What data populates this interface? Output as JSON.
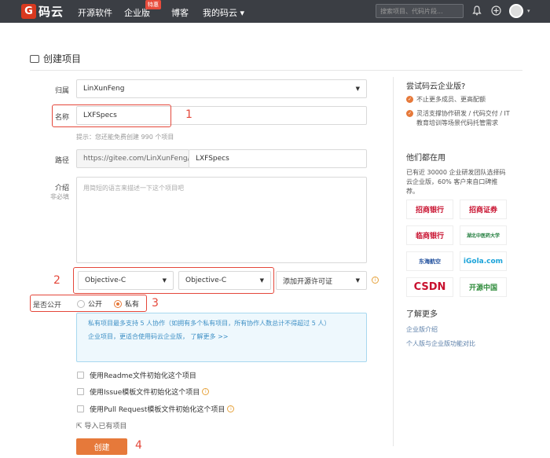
{
  "nav": {
    "logo_letter": "G",
    "logo_text": "码云",
    "items": [
      "开源软件",
      "企业版",
      "博客",
      "我的码云"
    ],
    "badge": "特惠",
    "search_placeholder": "搜索项目、代码片段...",
    "caret": "▾"
  },
  "page": {
    "title": "创建项目"
  },
  "form": {
    "owner_label": "归属",
    "owner_value": "LinXunFeng",
    "name_label": "名称",
    "name_value": "LXFSpecs",
    "name_hint": "提示：您还能免费创建 990 个项目",
    "path_label": "路径",
    "path_prefix": "https://gitee.com/LinXunFeng/",
    "path_value": "LXFSpecs",
    "desc_label": "介绍",
    "desc_sub": "非必填",
    "desc_placeholder": "用简短的语言来描述一下这个项目吧",
    "lang_value": "Objective-C",
    "gitignore_value": "Objective-C",
    "license_placeholder": "添加开源许可证",
    "visibility_label": "是否公开",
    "public_label": "公开",
    "private_label": "私有",
    "info_line1": "私有项目最多支持 5 人协作（如拥有多个私有项目，所有协作人数总计不得超过 5 人）",
    "info_line2": "企业项目，更适合使用码云企业版，  了解更多 >>",
    "cb_readme": "使用Readme文件初始化这个项目",
    "cb_issue": "使用Issue模板文件初始化这个项目",
    "cb_pr": "使用Pull Request模板文件初始化这个项目",
    "import_label": "导入已有项目",
    "create_label": "创建"
  },
  "annotations": [
    "1",
    "2",
    "3",
    "4"
  ],
  "sidebar": {
    "h1": "尝试码云企业版?",
    "li1": "不止更多成员、更高配额",
    "li2": "灵活支撑协作研发 / 代码交付 / IT 教育培训等场景代码托管需求",
    "h2": "他们都在用",
    "p": "已有近 30000 企业研发团队选择码云企业版，60% 客户来自口碑推荐。",
    "logos": [
      "招商银行",
      "招商证券",
      "临商银行",
      "湖北中医药大学",
      "东海航空",
      "iGola.com",
      "CSDN",
      "开源中国"
    ],
    "h3": "了解更多",
    "link1": "企业版介绍",
    "link2": "个人版与企业版功能对比"
  },
  "colors": {
    "accent": "#e6793a",
    "annotation": "#e4473a",
    "nav_bg": "#3b3e44"
  }
}
